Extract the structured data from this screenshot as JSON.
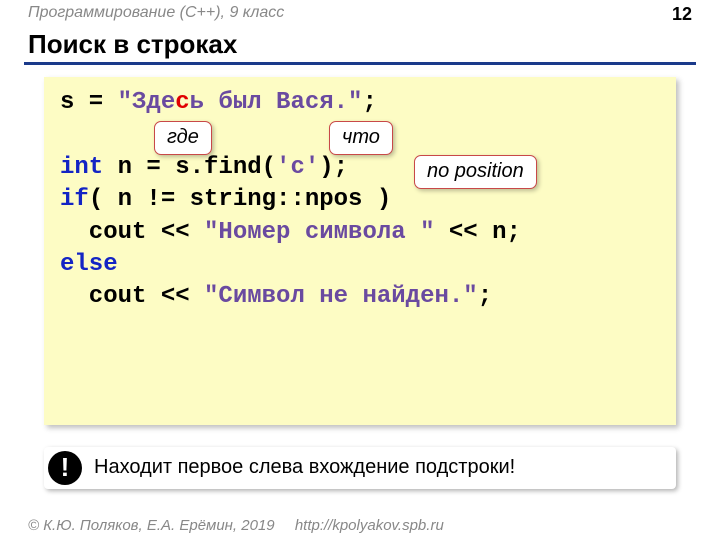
{
  "header": {
    "course": "Программирование (С++), 9 класс",
    "page": "12"
  },
  "title": "Поиск в строках",
  "code": {
    "l1a": "s = ",
    "l1b": "\"Зде",
    "l1c": "с",
    "l1d": "ь был Вася.\"",
    "l1e": ";",
    "l2": "",
    "l3a": "int",
    "l3b": " n = s.find(",
    "l3c": "'с'",
    "l3d": ");",
    "l4a": "if",
    "l4b": "( n != string::npos )",
    "l5a": "  cout << ",
    "l5b": "\"Номер символа \"",
    "l5c": " << n;",
    "l6a": "else",
    "l7a": "  cout << ",
    "l7b": "\"Символ не найден.\"",
    "l7c": ";"
  },
  "callouts": {
    "where": "где",
    "what": "что",
    "npos": "no position"
  },
  "note": {
    "icon": "!",
    "text": "Находит первое слева вхождение подстроки!"
  },
  "footer": {
    "copyright": "© К.Ю. Поляков, Е.А. Ерёмин, 2019",
    "url": "http://kpolyakov.spb.ru"
  }
}
